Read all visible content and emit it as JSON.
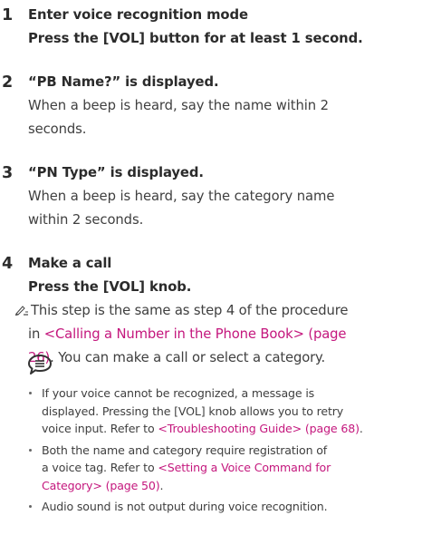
{
  "steps": [
    {
      "num": "1",
      "head1": "Enter voice recognition mode",
      "head2": "Press the [VOL] button for at least 1 second."
    },
    {
      "num": "2",
      "head1": "“PB Name?” is displayed.",
      "body1": "When a beep is heard, say the name within 2",
      "body2": "seconds."
    },
    {
      "num": "3",
      "head1": "“PN Type” is displayed.",
      "body1": "When a beep is heard, say the category name",
      "body2": "within 2 seconds."
    },
    {
      "num": "4",
      "head1": "Make a call",
      "head2": "Press the [VOL] knob.",
      "note1": "This step is the same as step 4 of the procedure",
      "note2_pre": "in ",
      "note2_link": "<Calling a Number in the Phone Book> (page",
      "note3_link": "26)",
      "note3_post": ". You can make a call or select a category."
    }
  ],
  "bullets": [
    {
      "l1": "If your voice cannot be recognized, a message is",
      "l2": "displayed. Pressing the [VOL] knob allows you to retry",
      "l3_pre": "voice input. Refer to ",
      "l3_link": "<Troubleshooting Guide> (page 68)",
      "l3_post": "."
    },
    {
      "l1": "Both the name and category require registration of",
      "l2_pre": "a voice tag. Refer to ",
      "l2_link": "<Setting a Voice Command for",
      "l3_link": "Category> (page 50)",
      "l3_post": "."
    },
    {
      "l1": "Audio sound is not output during voice recognition."
    }
  ],
  "colors": {
    "link": "#c4177d",
    "text": "#3f3f3f"
  },
  "icons": {
    "note": "pencil-note-icon",
    "memo": "memo-speech-bubble-icon"
  }
}
